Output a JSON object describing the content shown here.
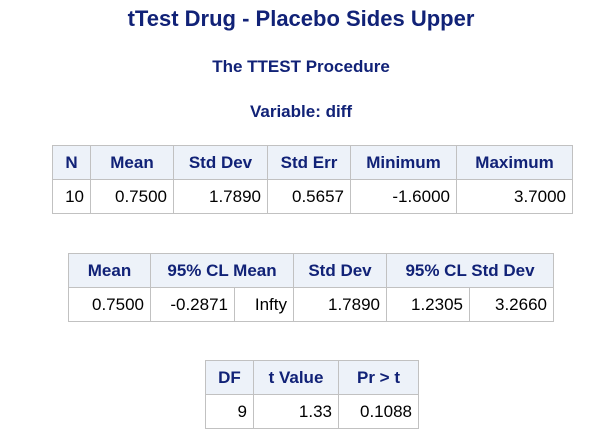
{
  "title": "tTest Drug - Placebo Sides Upper",
  "procedure": "The TTEST Procedure",
  "variable": "Variable: diff",
  "table1": {
    "headers": [
      "N",
      "Mean",
      "Std Dev",
      "Std Err",
      "Minimum",
      "Maximum"
    ],
    "row": [
      "10",
      "0.7500",
      "1.7890",
      "0.5657",
      "-1.6000",
      "3.7000"
    ]
  },
  "table2": {
    "headers": [
      "Mean",
      "95% CL Mean",
      "Std Dev",
      "95% CL Std Dev"
    ],
    "row": [
      "0.7500",
      "-0.2871",
      "Infty",
      "1.7890",
      "1.2305",
      "3.2660"
    ]
  },
  "table3": {
    "headers": [
      "DF",
      "t Value",
      "Pr > t"
    ],
    "row": [
      "9",
      "1.33",
      "0.1088"
    ]
  }
}
